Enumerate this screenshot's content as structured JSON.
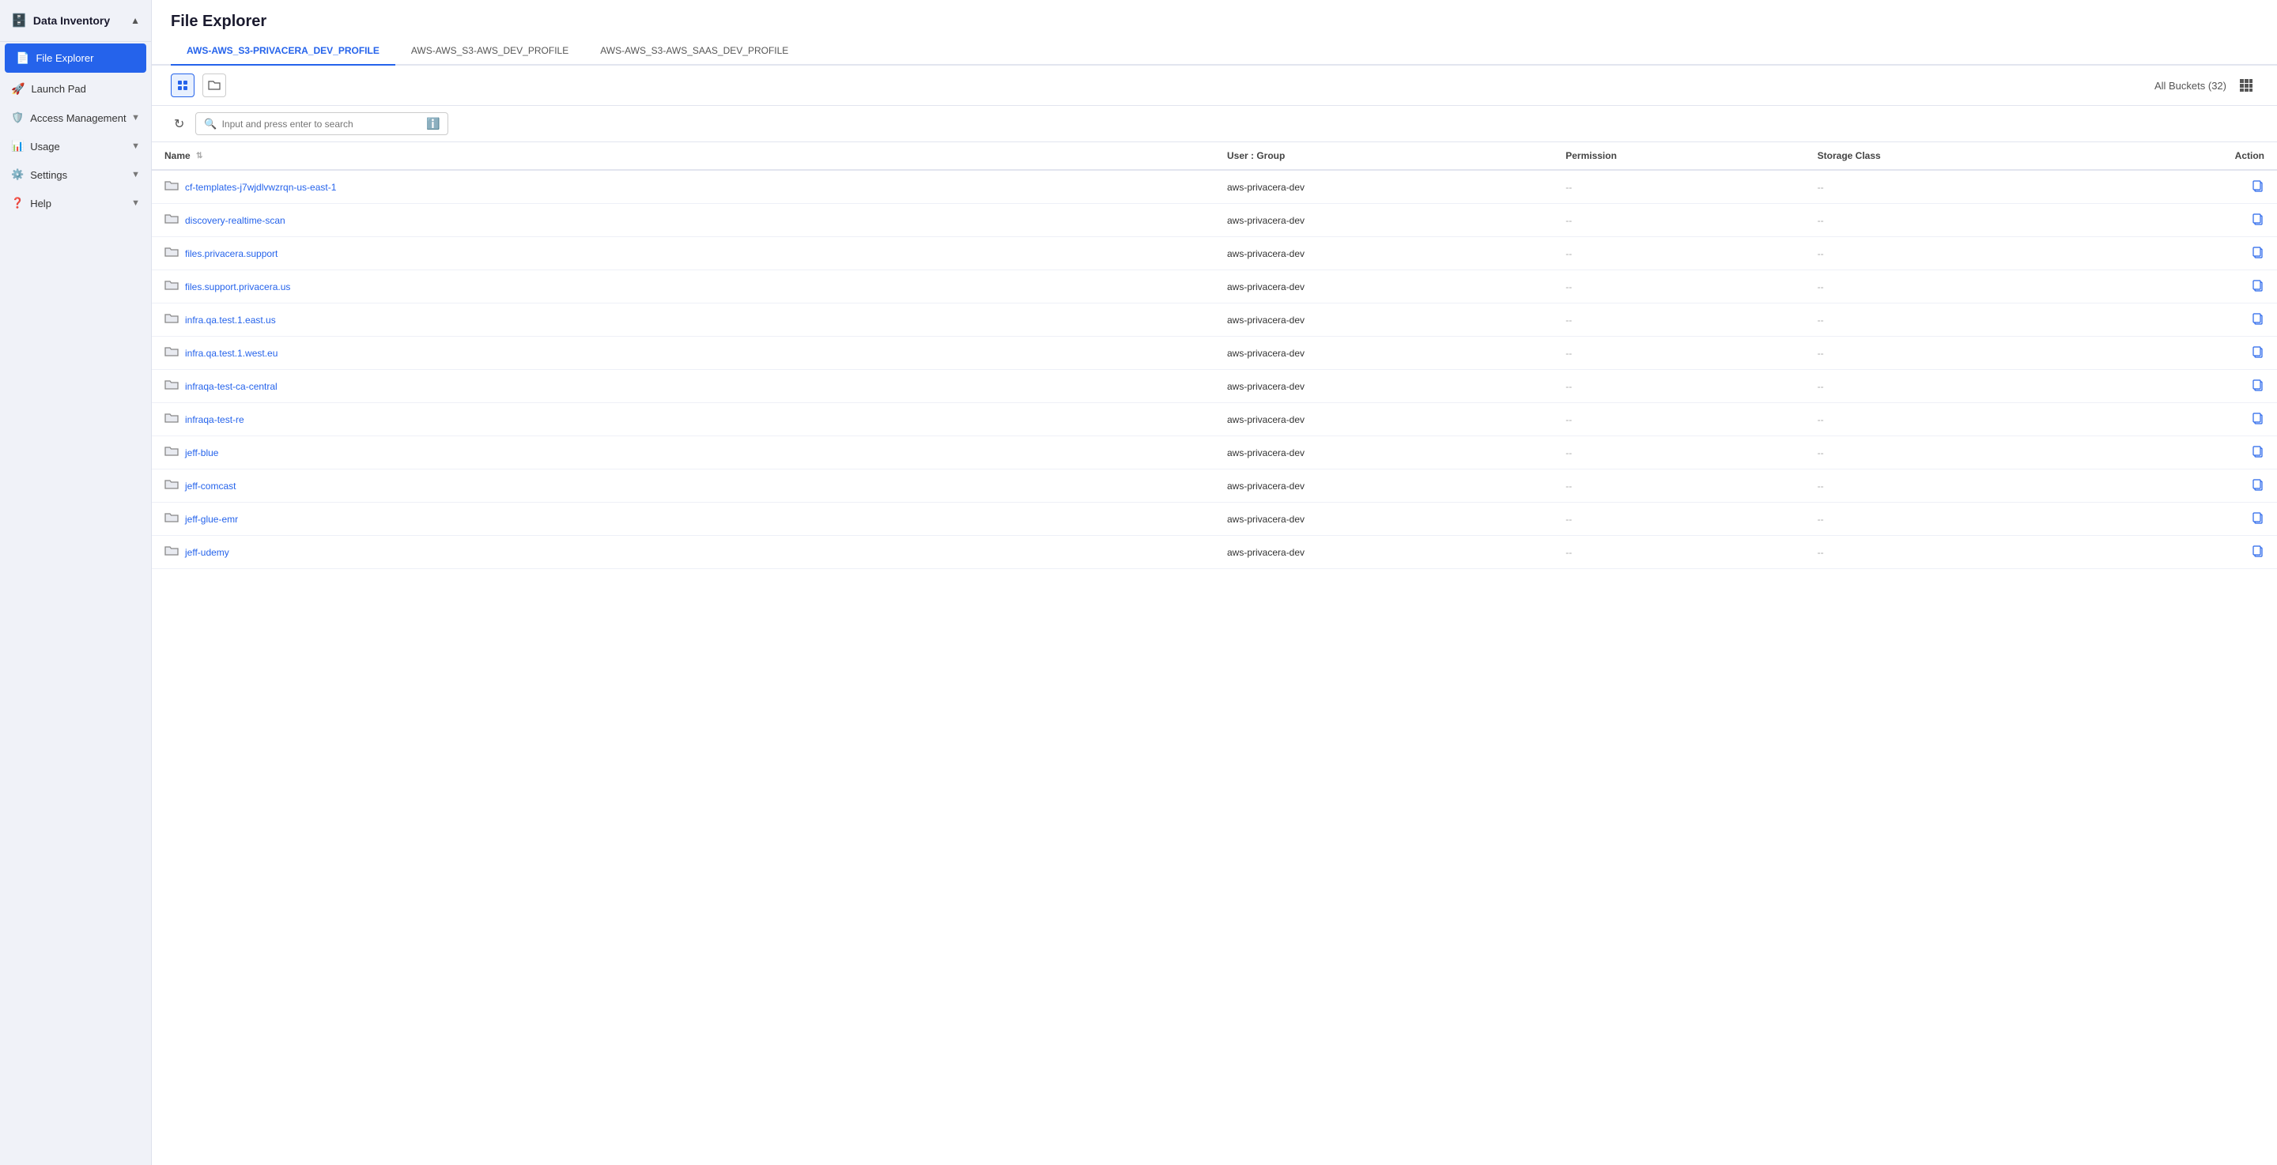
{
  "sidebar": {
    "header": "Data Inventory",
    "items": [
      {
        "id": "file-explorer",
        "label": "File Explorer",
        "icon": "🚀",
        "active": true
      },
      {
        "id": "launch-pad",
        "label": "Launch Pad",
        "icon": "🚀",
        "active": false
      }
    ],
    "sections": [
      {
        "id": "access-management",
        "label": "Access Management",
        "icon": "🛡️",
        "expanded": true
      },
      {
        "id": "usage",
        "label": "Usage",
        "icon": "📊",
        "expanded": false
      },
      {
        "id": "settings",
        "label": "Settings",
        "icon": "⚙️",
        "expanded": false
      },
      {
        "id": "help",
        "label": "Help",
        "icon": "❓",
        "expanded": false
      }
    ]
  },
  "page": {
    "title": "File Explorer"
  },
  "tabs": [
    {
      "id": "tab1",
      "label": "AWS-AWS_S3-PRIVACERA_DEV_PROFILE",
      "active": true
    },
    {
      "id": "tab2",
      "label": "AWS-AWS_S3-AWS_DEV_PROFILE",
      "active": false
    },
    {
      "id": "tab3",
      "label": "AWS-AWS_S3-AWS_SAAS_DEV_PROFILE",
      "active": false
    }
  ],
  "toolbar": {
    "all_buckets_label": "All Buckets (32)",
    "file_icon_tooltip": "File view",
    "folder_icon_tooltip": "Folder view"
  },
  "search": {
    "placeholder": "Input and press enter to search",
    "refresh_tooltip": "Refresh"
  },
  "table": {
    "columns": [
      {
        "id": "name",
        "label": "Name",
        "sortable": true
      },
      {
        "id": "user_group",
        "label": "User : Group"
      },
      {
        "id": "permission",
        "label": "Permission"
      },
      {
        "id": "storage_class",
        "label": "Storage Class"
      },
      {
        "id": "action",
        "label": "Action"
      }
    ],
    "rows": [
      {
        "name": "cf-templates-j7wjdlvwzrqn-us-east-1",
        "user_group": "aws-privacera-dev",
        "permission": "--",
        "storage_class": "--"
      },
      {
        "name": "discovery-realtime-scan",
        "user_group": "aws-privacera-dev",
        "permission": "--",
        "storage_class": "--"
      },
      {
        "name": "files.privacera.support",
        "user_group": "aws-privacera-dev",
        "permission": "--",
        "storage_class": "--"
      },
      {
        "name": "files.support.privacera.us",
        "user_group": "aws-privacera-dev",
        "permission": "--",
        "storage_class": "--"
      },
      {
        "name": "infra.qa.test.1.east.us",
        "user_group": "aws-privacera-dev",
        "permission": "--",
        "storage_class": "--"
      },
      {
        "name": "infra.qa.test.1.west.eu",
        "user_group": "aws-privacera-dev",
        "permission": "--",
        "storage_class": "--"
      },
      {
        "name": "infraqa-test-ca-central",
        "user_group": "aws-privacera-dev",
        "permission": "--",
        "storage_class": "--"
      },
      {
        "name": "infraqa-test-re",
        "user_group": "aws-privacera-dev",
        "permission": "--",
        "storage_class": "--"
      },
      {
        "name": "jeff-blue",
        "user_group": "aws-privacera-dev",
        "permission": "--",
        "storage_class": "--"
      },
      {
        "name": "jeff-comcast",
        "user_group": "aws-privacera-dev",
        "permission": "--",
        "storage_class": "--"
      },
      {
        "name": "jeff-glue-emr",
        "user_group": "aws-privacera-dev",
        "permission": "--",
        "storage_class": "--"
      },
      {
        "name": "jeff-udemy",
        "user_group": "aws-privacera-dev",
        "permission": "--",
        "storage_class": "--"
      }
    ]
  }
}
